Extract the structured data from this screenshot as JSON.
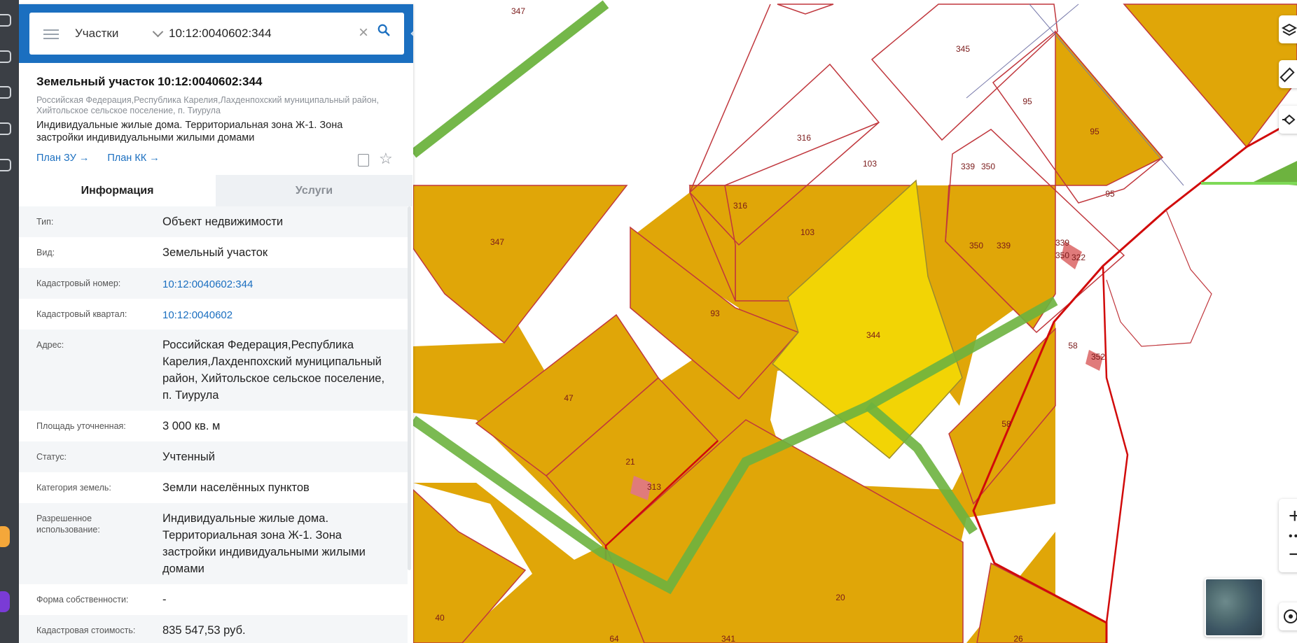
{
  "search": {
    "type_label": "Участки",
    "query": "10:12:0040602:344"
  },
  "card": {
    "title": "Земельный участок 10:12:0040602:344",
    "address": "Российская Федерация,Республика Карелия,Лахденпохский муниципальный район, Хийтольское сельское поселение, п. Тиурула",
    "description": "Индивидуальные жилые дома. Территориальная зона Ж-1. Зона застройки индивидуальными жилыми домами",
    "link_plan_zu": "План ЗУ →",
    "link_plan_kk": "План КК →"
  },
  "tabs": {
    "info": "Информация",
    "services": "Услуги"
  },
  "info_rows": [
    {
      "label": "Тип:",
      "value": "Объект недвижимости"
    },
    {
      "label": "Вид:",
      "value": "Земельный участок"
    },
    {
      "label": "Кадастровый номер:",
      "value": "10:12:0040602:344"
    },
    {
      "label": "Кадастровый квартал:",
      "value": "10:12:0040602"
    },
    {
      "label": "Адрес:",
      "value": "Российская Федерация,Республика Карелия,Лахденпохский муниципальный район, Хийтольское сельское поселение, п. Тиурула"
    },
    {
      "label": "Площадь уточненная:",
      "value": "3 000 кв. м"
    },
    {
      "label": "Статус:",
      "value": "Учтенный"
    },
    {
      "label": "Категория земель:",
      "value": "Земли населённых пунктов"
    },
    {
      "label": "Разрешенное использование:",
      "value": "Индивидуальные жилые дома. Территориальная зона Ж-1. Зона застройки индивидуальными жилыми домами"
    },
    {
      "label": "Форма собственности:",
      "value": "-"
    },
    {
      "label": "Кадастровая стоимость:",
      "value": "835 547,53 руб."
    }
  ],
  "map": {
    "parcel_labels": [
      "347",
      "345",
      "95",
      "316",
      "103",
      "339",
      "350",
      "93",
      "344",
      "58",
      "47",
      "21",
      "313",
      "20",
      "40",
      "64",
      "341",
      "26",
      "322",
      "352"
    ],
    "colors": {
      "parcel_fill": "#e0a608",
      "selected_fill": "#f2d405",
      "road": "#6db33f",
      "boundary": "#c0373d",
      "zone_border": "#d10a0a",
      "building": "#e07b7b",
      "panel_header": "#1b6fc0"
    }
  },
  "controls": {
    "zoom_in": "+",
    "zoom_out": "−"
  }
}
